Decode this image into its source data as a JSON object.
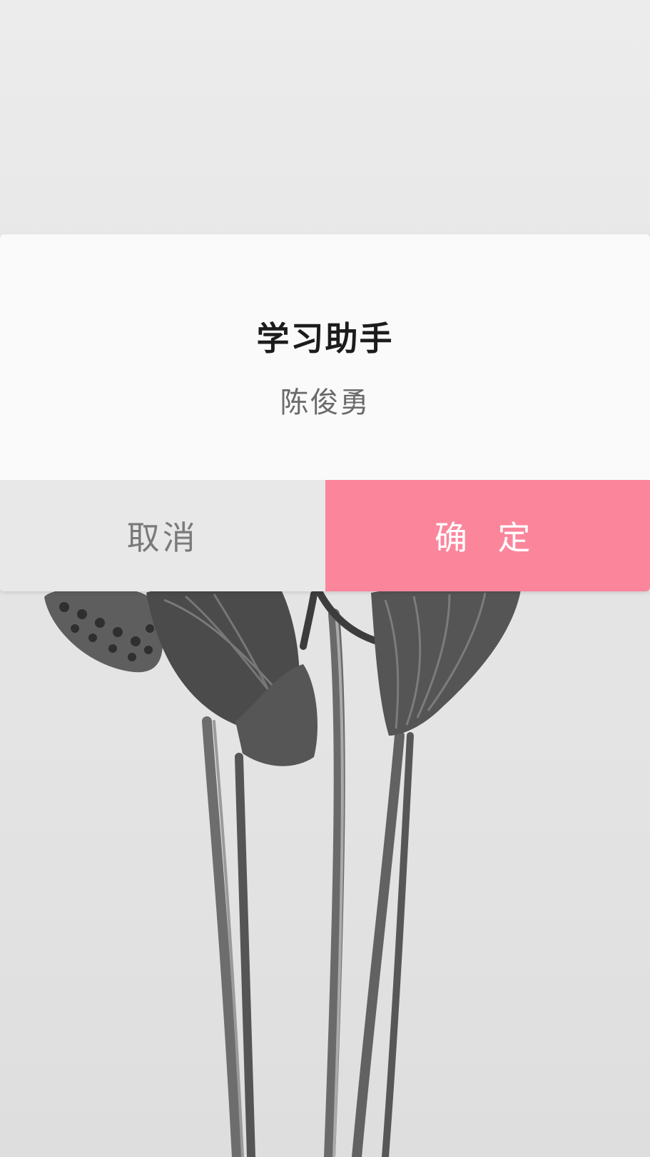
{
  "background": {
    "image": "dried-lotus-pods-photo"
  },
  "dialog": {
    "title": "学习助手",
    "message": "陈俊勇",
    "cancel_label": "取消",
    "confirm_label": "确 定",
    "confirm_color": "#fb869c",
    "cancel_color": "#e8e8e8"
  }
}
